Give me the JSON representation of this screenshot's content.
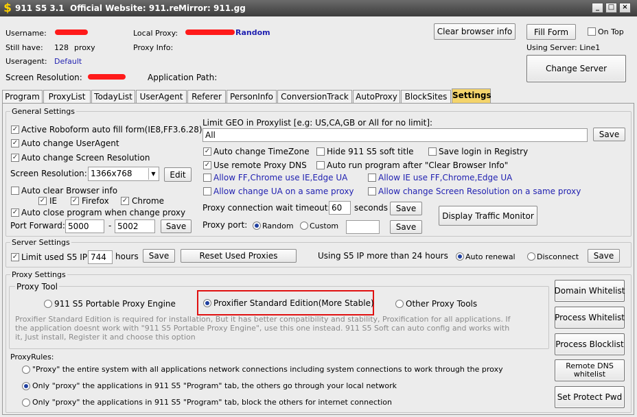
{
  "titlebar": {
    "icon": "$",
    "app_name": "911 S5 3.1",
    "website": "Official Website: 911.re",
    "mirror": "Mirror: 911.gg"
  },
  "info": {
    "username_label": "Username:",
    "still_have_label": "Still have:",
    "still_have_value": "128",
    "still_have_unit": "proxy",
    "useragent_label": "Useragent:",
    "useragent_value": "Default",
    "screen_res_label": "Screen Resolution:",
    "local_proxy_label": "Local Proxy:",
    "local_proxy_value": "Random",
    "proxy_info_label": "Proxy Info:",
    "app_path_label": "Application Path:"
  },
  "top_buttons": {
    "clear_browser": "Clear browser info",
    "fill_form": "Fill Form",
    "on_top": "On Top",
    "using_server": "Using Server: Line1",
    "change_server": "Change Server"
  },
  "tabs": [
    "Program",
    "ProxyList",
    "TodayList",
    "UserAgent",
    "Referer",
    "PersonInfo",
    "ConversionTrack",
    "AutoProxy",
    "BlockSites",
    "Settings"
  ],
  "general": {
    "title": "General Settings",
    "roboform": "Active Roboform auto fill form(IE8,FF3.6.28)",
    "change_ua": "Auto change UserAgent",
    "change_res": "Auto change Screen Resolution",
    "screen_res_label": "Screen Resolution:",
    "screen_res_value": "1366x768",
    "edit": "Edit",
    "clear_browser": "Auto clear Browser info",
    "ie": "IE",
    "firefox": "Firefox",
    "chrome": "Chrome",
    "close_program": "Auto close program when change proxy",
    "port_forward_label": "Port Forward:",
    "port_from": "5000",
    "port_dash": "-",
    "port_to": "5002",
    "save": "Save",
    "geo_label": "Limit GEO in Proxylist [e.g:  US,CA,GB  or All for no limit]:",
    "geo_value": "All",
    "auto_timezone": "Auto change TimeZone",
    "hide_title": "Hide 911 S5 soft title",
    "save_login": "Save login in Registry",
    "remote_dns": "Use remote Proxy DNS",
    "auto_run": "Auto run program after \"Clear Browser Info\"",
    "allow_ff_chrome": "Allow FF,Chrome use IE,Edge UA",
    "allow_ie": "Allow IE use FF,Chrome,Edge UA",
    "allow_ua_same": "Allow change UA on a same proxy",
    "allow_res_same": "Allow change Screen Resolution on a same proxy",
    "timeout_label": "Proxy connection wait timeout:",
    "timeout_value": "60",
    "seconds": "seconds",
    "proxy_port_label": "Proxy port:",
    "random": "Random",
    "custom": "Custom",
    "traffic_monitor": "Display Traffic Monitor"
  },
  "server": {
    "title": "Server Settings",
    "limit_used": "Limit used S5 IP",
    "limit_value": "744",
    "hours": "hours",
    "save": "Save",
    "reset": "Reset Used Proxies",
    "using_more": "Using S5 IP more than 24 hours",
    "auto_renewal": "Auto renewal",
    "disconnect": "Disconnect"
  },
  "proxy": {
    "title": "Proxy Settings",
    "tool_title": "Proxy Tool",
    "portable": "911 S5 Portable Proxy Engine",
    "proxifier": "Proxifier Standard Edition(More Stable)",
    "other": "Other Proxy Tools",
    "desc1": "Proxifier Standard Edition is required for installation, But it has better compatibility and stability, Proxification for all applications. If",
    "desc2": "the application doesnt work with \"911 S5 Portable Proxy Engine\", use this one instead. 911 S5 Soft can auto config and works with",
    "desc3": "it, Just install, Register it and choose this option",
    "rules_title": "ProxyRules:",
    "rule1": "\"Proxy\" the entire system with all applications network connections including system connections to work through the proxy",
    "rule2": "Only \"proxy\" the applications in 911 S5 \"Program\" tab, the others go through your local network",
    "rule3": "Only \"proxy\" the applications in 911 S5 \"Program\" tab, block the others for internet connection"
  },
  "side_buttons": {
    "domain_whitelist": "Domain Whitelist",
    "process_whitelist": "Process Whitelist",
    "process_blocklist": "Process Blocklist",
    "remote_dns_1": "Remote DNS",
    "remote_dns_2": "whitelist",
    "protect_pwd": "Set Protect Pwd"
  },
  "colors": {
    "titlebar": "#4a4a4a",
    "active_tab": "#f4d46b",
    "link_blue": "#1f1fb0",
    "highlight_red": "#e01010"
  }
}
